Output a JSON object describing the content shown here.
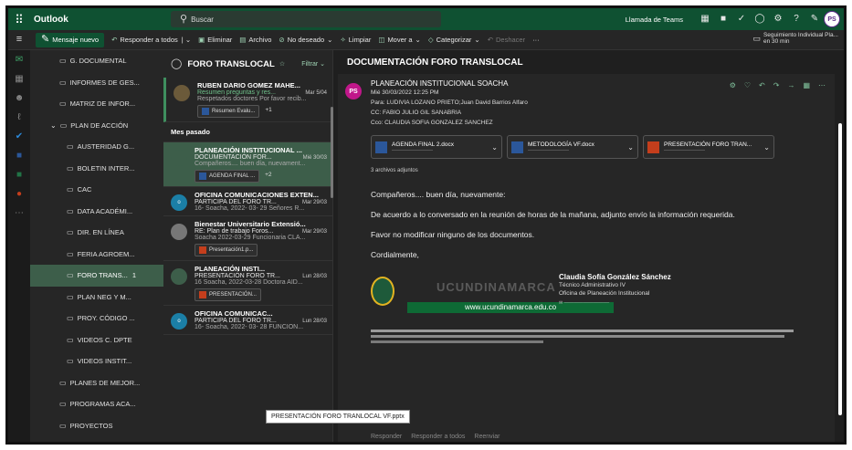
{
  "app": {
    "name": "Outlook",
    "waffle": "⠿"
  },
  "search": {
    "placeholder": "Buscar",
    "icon": "search-icon"
  },
  "topbar": {
    "teams_label": "Llamada de Teams",
    "avatar_initials": "PS"
  },
  "toolbar": {
    "new_mail": "Mensaje nuevo",
    "reply_all": "Responder a todos",
    "delete": "Eliminar",
    "archive": "Archivo",
    "junk": "No deseado",
    "sweep": "Limpiar",
    "move": "Mover a",
    "categorize": "Categorizar",
    "undo": "Deshacer",
    "more": "···",
    "followup_title": "Seguimiento Individual Pla...",
    "followup_time": "en 30 min"
  },
  "folders": [
    {
      "label": "G. DOCUMENTAL",
      "level": 2
    },
    {
      "label": "INFORMES DE GES...",
      "level": 2
    },
    {
      "label": "MATRIZ DE INFOR...",
      "level": 2
    },
    {
      "label": "PLAN DE ACCIÓN",
      "level": 1
    },
    {
      "label": "AUSTERIDAD G...",
      "level": 3
    },
    {
      "label": "BOLETIN INTER...",
      "level": 3
    },
    {
      "label": "CAC",
      "level": 3
    },
    {
      "label": "DATA ACADÉMI...",
      "level": 3
    },
    {
      "label": "DIR. EN LÍNEA",
      "level": 3
    },
    {
      "label": "FERIA AGROEM...",
      "level": 3
    },
    {
      "label": "FORO TRANS...",
      "level": 3,
      "count": "1",
      "selected": true
    },
    {
      "label": "PLAN NEG Y M...",
      "level": 3
    },
    {
      "label": "PROY. CÓDIGO ...",
      "level": 3
    },
    {
      "label": "VIDEOS C. DPTE",
      "level": 3
    },
    {
      "label": "VIDEOS INSTIT...",
      "level": 3
    },
    {
      "label": "PLANES DE MEJOR...",
      "level": 2
    },
    {
      "label": "PROGRAMAS ACA...",
      "level": 2
    },
    {
      "label": "PROYECTOS",
      "level": 2
    }
  ],
  "message_list": {
    "title": "FORO TRANSLOCAL",
    "filter": "Filtrar",
    "group_label": "Mes pasado",
    "messages": [
      {
        "from": "RUBEN DARIO GOMEZ MAHE...",
        "subject": "Resumen preguntas y res...",
        "date": "Mar 5/04",
        "preview": "Respetados doctores Por favor recib...",
        "attachment": "Resumen Evalu...",
        "more": "+1",
        "avatar": "",
        "color": "#6b5a3a"
      },
      {
        "from": "PLANEACIÓN INSTITUCIONAL ...",
        "subject": "DOCUMENTACIÓN FOR...",
        "date": "Mié 30/03",
        "preview": "Compañeros.... buen día, nuevament...",
        "attachment": "AGENDA FINAL ...",
        "more": "+2",
        "avatar": "",
        "color": "#3d5e4a"
      },
      {
        "from": "OFICINA COMUNICACIONES EXTEN...",
        "subject": "PARTICIPA DEL FORO TR...",
        "date": "Mar 29/03",
        "preview": "16- Soacha, 2022- 03- 29 Señores R...",
        "attachment": "",
        "more": "",
        "avatar": "o",
        "color": "#1b7fa6"
      },
      {
        "from": "Bienestar Universitario Extensió...",
        "subject": "RE: Plan de trabajo Foros...",
        "date": "Mar 29/03",
        "preview": "Soacha 2022-03-29 Funcionaria CLA...",
        "attachment": "Presentación1.p...",
        "more": "",
        "avatar": "",
        "color": "#777"
      },
      {
        "from": "PLANEACIÓN INSTI...",
        "subject": "PRESENTACIÓN FORO TR...",
        "date": "Lun 28/03",
        "preview": "16 Soacha, 2022-03-28 Doctora AID...",
        "attachment": "PRESENTACIÓN...",
        "more": "",
        "avatar": "",
        "color": "#3d5e4a"
      },
      {
        "from": "OFICINA COMUNICAC...",
        "subject": "PARTICIPA DEL FORO TR...",
        "date": "Lun 28/03",
        "preview": "16- Soacha, 2022- 03- 28 FUNCION...",
        "attachment": "",
        "more": "",
        "avatar": "o",
        "color": "#1b7fa6"
      }
    ],
    "tooltip": "PRESENTACIÓN FORO TRANLOCAL VF.pptx"
  },
  "reading": {
    "title": "DOCUMENTACIÓN FORO TRANSLOCAL",
    "sender": "PLANEACIÓN INSTITUCIONAL SOACHA",
    "sender_initials": "PS",
    "date": "Mié 30/03/2022 12:25 PM",
    "to": "Para: LUDIVIA LOZANO PRIETO;Juan David Barrios Alfaro",
    "cc": "CC: FABIO JULIO GIL SANABRIA",
    "bcc": "Cco: CLAUDIA SOFIA GONZALEZ SANCHEZ",
    "attachments": [
      {
        "name": "AGENDA FINAL 2.docx",
        "type": "word"
      },
      {
        "name": "METODOLOGÍA VF.docx",
        "type": "word"
      },
      {
        "name": "PRESENTACIÓN FORO TRAN...",
        "type": "ppt"
      }
    ],
    "attachment_count": "3 archivos adjuntos",
    "body": [
      "Compañeros.... buen día, nuevamente:",
      "De acuerdo a lo conversado en la reunión de horas de la mañana, adjunto envío la información requerida.",
      "Favor no modificar ninguno de los documentos.",
      "Cordialmente,"
    ],
    "signature": {
      "name": "Claudia Sofía González Sánchez",
      "role": "Técnico Administrativo IV",
      "office": "Oficina de Planeación Institucional",
      "watermark": "UCUNDINAMARCA",
      "url": "www.ucundinamarca.edu.co"
    },
    "reply_actions": [
      "Responder",
      "Responder a todos",
      "Reenviar"
    ]
  },
  "colors": {
    "brand": "#0f5132",
    "accent": "#3d5e4a",
    "pane": "#262626"
  }
}
